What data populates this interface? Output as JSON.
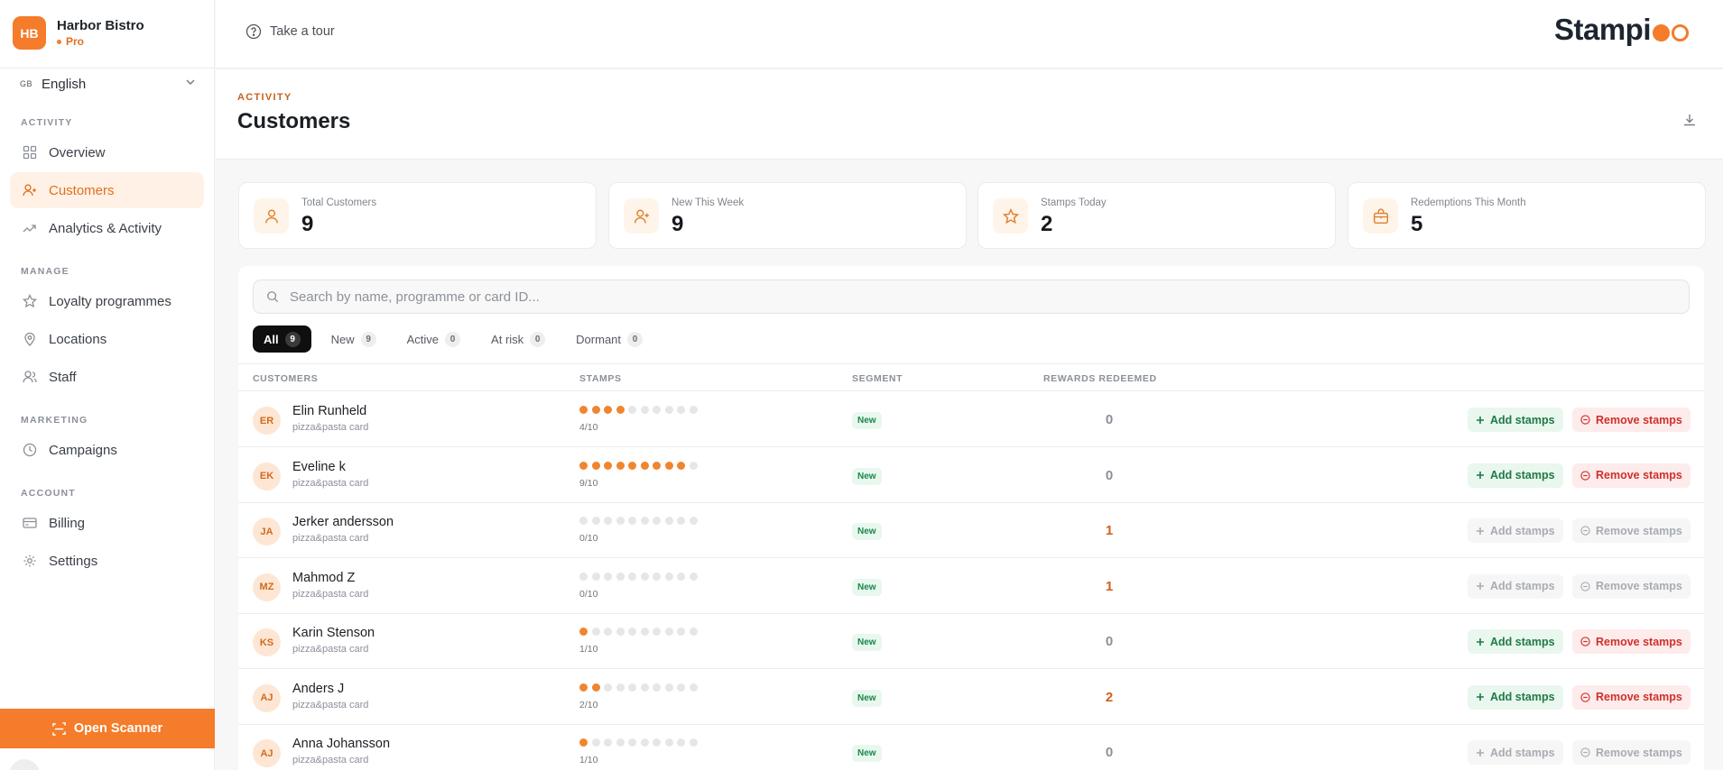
{
  "brand": {
    "initials": "HB",
    "name": "Harbor Bistro",
    "plan": "Pro"
  },
  "language": {
    "flag": "GB",
    "label": "English"
  },
  "sidebar": {
    "sections": [
      {
        "label": "ACTIVITY",
        "items": [
          {
            "label": "Overview",
            "icon": "grid-icon"
          },
          {
            "label": "Customers",
            "icon": "user-plus-icon",
            "active": true
          },
          {
            "label": "Analytics & Activity",
            "icon": "trend-icon"
          }
        ]
      },
      {
        "label": "MANAGE",
        "items": [
          {
            "label": "Loyalty programmes",
            "icon": "star-icon"
          },
          {
            "label": "Locations",
            "icon": "map-pin-icon"
          },
          {
            "label": "Staff",
            "icon": "users-icon"
          }
        ]
      },
      {
        "label": "MARKETING",
        "items": [
          {
            "label": "Campaigns",
            "icon": "clock-icon"
          }
        ]
      },
      {
        "label": "ACCOUNT",
        "items": [
          {
            "label": "Billing",
            "icon": "card-icon"
          },
          {
            "label": "Settings",
            "icon": "gear-icon"
          }
        ]
      }
    ],
    "scanner_label": "Open Scanner"
  },
  "topbar": {
    "tour_label": "Take a tour",
    "logo_text": "Stampi"
  },
  "header": {
    "eyebrow": "ACTIVITY",
    "title": "Customers"
  },
  "stats": [
    {
      "label": "Total Customers",
      "value": "9",
      "icon": "user-icon"
    },
    {
      "label": "New This Week",
      "value": "9",
      "icon": "user-plus-icon"
    },
    {
      "label": "Stamps Today",
      "value": "2",
      "icon": "star-icon"
    },
    {
      "label": "Redemptions This Month",
      "value": "5",
      "icon": "gift-icon"
    }
  ],
  "search": {
    "placeholder": "Search by name, programme or card ID..."
  },
  "filters": [
    {
      "label": "All",
      "count": "9",
      "active": true
    },
    {
      "label": "New",
      "count": "9"
    },
    {
      "label": "Active",
      "count": "0"
    },
    {
      "label": "At risk",
      "count": "0"
    },
    {
      "label": "Dormant",
      "count": "0"
    }
  ],
  "table": {
    "columns": [
      "CUSTOMERS",
      "STAMPS",
      "SEGMENT",
      "REWARDS REDEEMED"
    ],
    "add_label": "Add stamps",
    "remove_label": "Remove stamps",
    "rows": [
      {
        "initials": "ER",
        "name": "Elin Runheld",
        "programme": "pizza&pasta card",
        "stamps": 4,
        "max": 10,
        "stamps_text": "4/10",
        "segment": "New",
        "redeemed": "0",
        "actions_enabled": true
      },
      {
        "initials": "EK",
        "name": "Eveline k",
        "programme": "pizza&pasta card",
        "stamps": 9,
        "max": 10,
        "stamps_text": "9/10",
        "segment": "New",
        "redeemed": "0",
        "actions_enabled": true
      },
      {
        "initials": "JA",
        "name": "Jerker andersson",
        "programme": "pizza&pasta card",
        "stamps": 0,
        "max": 10,
        "stamps_text": "0/10",
        "segment": "New",
        "redeemed": "1",
        "actions_enabled": false
      },
      {
        "initials": "MZ",
        "name": "Mahmod Z",
        "programme": "pizza&pasta card",
        "stamps": 0,
        "max": 10,
        "stamps_text": "0/10",
        "segment": "New",
        "redeemed": "1",
        "actions_enabled": false
      },
      {
        "initials": "KS",
        "name": "Karin Stenson",
        "programme": "pizza&pasta card",
        "stamps": 1,
        "max": 10,
        "stamps_text": "1/10",
        "segment": "New",
        "redeemed": "0",
        "actions_enabled": true
      },
      {
        "initials": "AJ",
        "name": "Anders J",
        "programme": "pizza&pasta card",
        "stamps": 2,
        "max": 10,
        "stamps_text": "2/10",
        "segment": "New",
        "redeemed": "2",
        "actions_enabled": true
      },
      {
        "initials": "AJ",
        "name": "Anna Johansson",
        "programme": "pizza&pasta card",
        "stamps": 1,
        "max": 10,
        "stamps_text": "1/10",
        "segment": "New",
        "redeemed": "0",
        "actions_enabled": false
      }
    ]
  },
  "colors": {
    "accent": "#f47c2a",
    "active_bg": "#fff1e6",
    "segment_green": "#18874a",
    "remove_red": "#d0302b"
  }
}
